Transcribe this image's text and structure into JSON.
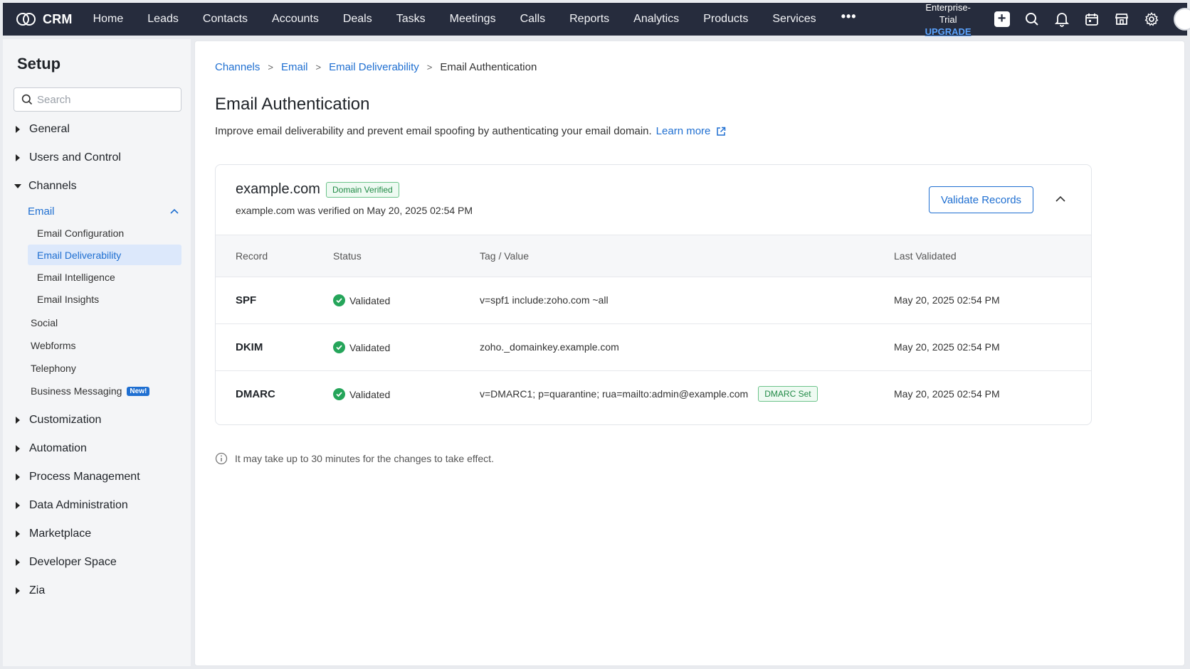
{
  "app": {
    "name": "CRM"
  },
  "nav": [
    "Home",
    "Leads",
    "Contacts",
    "Accounts",
    "Deals",
    "Tasks",
    "Meetings",
    "Calls",
    "Reports",
    "Analytics",
    "Products",
    "Services"
  ],
  "nav_more": "•••",
  "trial": {
    "edition": "Enterprise-Trial",
    "upgrade": "UPGRADE"
  },
  "sidebar": {
    "title": "Setup",
    "search_placeholder": "Search",
    "sections": {
      "general": "General",
      "users": "Users and Control",
      "channels": "Channels",
      "customization": "Customization",
      "automation": "Automation",
      "process": "Process Management",
      "data": "Data Administration",
      "marketplace": "Marketplace",
      "developer": "Developer Space",
      "zia": "Zia"
    },
    "email": "Email",
    "email_items": [
      "Email Configuration",
      "Email Deliverability",
      "Email Intelligence",
      "Email Insights"
    ],
    "channel_items": [
      "Social",
      "Webforms",
      "Telephony",
      "Business Messaging"
    ],
    "new_badge": "New!"
  },
  "breadcrumb": [
    "Channels",
    "Email",
    "Email Deliverability"
  ],
  "breadcrumb_current": "Email Authentication",
  "page": {
    "title": "Email Authentication",
    "description": "Improve email deliverability and prevent email spoofing by authenticating your email domain.",
    "learn_more": "Learn more"
  },
  "domain": {
    "name": "example.com",
    "badge": "Domain Verified",
    "verified_text": "example.com was verified on May 20, 2025 02:54 PM",
    "validate_button": "Validate Records"
  },
  "table": {
    "headers": {
      "record": "Record",
      "status": "Status",
      "value": "Tag / Value",
      "last": "Last Validated"
    },
    "rows": [
      {
        "record": "SPF",
        "status": "Validated",
        "value": "v=spf1 include:zoho.com ~all",
        "last": "May 20, 2025 02:54 PM"
      },
      {
        "record": "DKIM",
        "status": "Validated",
        "value": "zoho._domainkey.example.com",
        "last": "May 20, 2025 02:54 PM"
      },
      {
        "record": "DMARC",
        "status": "Validated",
        "value": "v=DMARC1; p=quarantine; rua=mailto:admin@example.com",
        "last": "May 20, 2025 02:54 PM",
        "badge": "DMARC Set"
      }
    ]
  },
  "note": "It may take up to 30 minutes for the changes to take effect.",
  "colors": {
    "topbar": "#262c3d",
    "accent": "#1f6fd1",
    "success": "#25a55a"
  }
}
